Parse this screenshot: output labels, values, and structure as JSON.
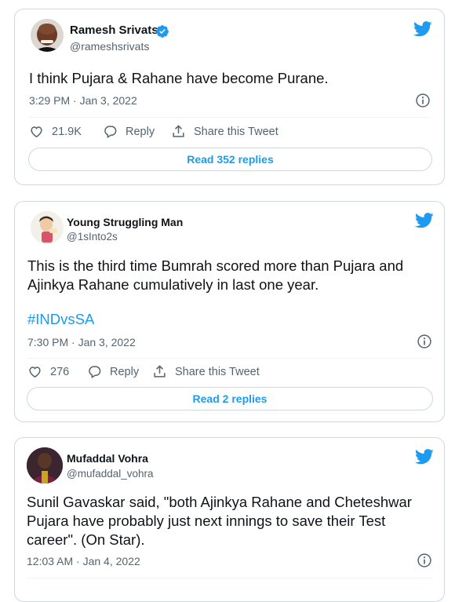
{
  "tweets": [
    {
      "name": "Ramesh Srivats",
      "handle": "@rameshsrivats",
      "verified": true,
      "text": "I think Pujara & Rahane have become Purane.",
      "time": "3:29 PM · Jan 3, 2022",
      "likes": "21.9K",
      "reply_label": "Reply",
      "share_label": "Share this Tweet",
      "read_replies": "Read 352 replies"
    },
    {
      "name": "Young Struggling Man",
      "handle": "@1sInto2s",
      "verified": false,
      "text": "This is the third time Bumrah scored more than Pujara and\nAjinkya Rahane cumulatively in last one year.",
      "hashtag": "#INDvsSA",
      "time": "7:30 PM · Jan 3, 2022",
      "likes": "276",
      "reply_label": "Reply",
      "share_label": "Share this Tweet",
      "read_replies": "Read 2 replies"
    },
    {
      "name": "Mufaddal Vohra",
      "handle": "@mufaddal_vohra",
      "verified": false,
      "text": "Sunil Gavaskar said, \"both Ajinkya Rahane and Cheteshwar\nPujara have probably just next innings to save their Test\ncareer\". (On Star).",
      "time": "12:03 AM · Jan 4, 2022"
    }
  ],
  "icons": {
    "brand": "twitter-bird-icon",
    "verified": "verified-badge-icon",
    "info": "info-icon",
    "like": "heart-icon",
    "reply": "reply-bubble-icon",
    "share": "share-icon"
  },
  "colors": {
    "brand_blue": "#1d9bf0",
    "secondary_text": "#536471",
    "border": "#cfd9de"
  }
}
